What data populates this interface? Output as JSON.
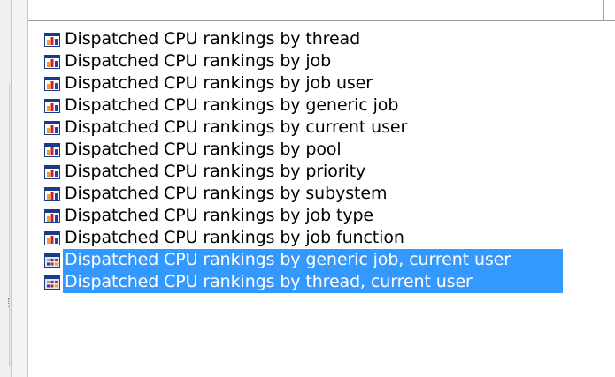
{
  "list": {
    "items": [
      {
        "label": "Dispatched CPU rankings by thread",
        "icon": "bar-chart-icon",
        "selected": false
      },
      {
        "label": "Dispatched CPU rankings by job",
        "icon": "bar-chart-icon",
        "selected": false
      },
      {
        "label": "Dispatched CPU rankings by job user",
        "icon": "bar-chart-icon",
        "selected": false
      },
      {
        "label": "Dispatched CPU rankings by generic job",
        "icon": "bar-chart-icon",
        "selected": false
      },
      {
        "label": "Dispatched CPU rankings by current user",
        "icon": "bar-chart-icon",
        "selected": false
      },
      {
        "label": "Dispatched CPU rankings by pool",
        "icon": "bar-chart-icon",
        "selected": false
      },
      {
        "label": "Dispatched CPU rankings by priority",
        "icon": "bar-chart-icon",
        "selected": false
      },
      {
        "label": "Dispatched CPU rankings by subystem",
        "icon": "bar-chart-icon",
        "selected": false
      },
      {
        "label": "Dispatched CPU rankings by job type",
        "icon": "bar-chart-icon",
        "selected": false
      },
      {
        "label": "Dispatched CPU rankings by job function",
        "icon": "bar-chart-icon",
        "selected": false
      },
      {
        "label": "Dispatched CPU rankings by generic job, current user",
        "icon": "grid-chart-icon",
        "selected": true
      },
      {
        "label": "Dispatched CPU rankings by thread, current user",
        "icon": "grid-chart-icon",
        "selected": true
      }
    ]
  },
  "colors": {
    "selection": "#3399ff",
    "selection_text": "#ffffff",
    "text": "#000000",
    "icon_frame": "#1a3a8a",
    "icon_bar_orange": "#f0a020",
    "icon_bar_red": "#d02020",
    "icon_bar_blue": "#2040c0"
  }
}
